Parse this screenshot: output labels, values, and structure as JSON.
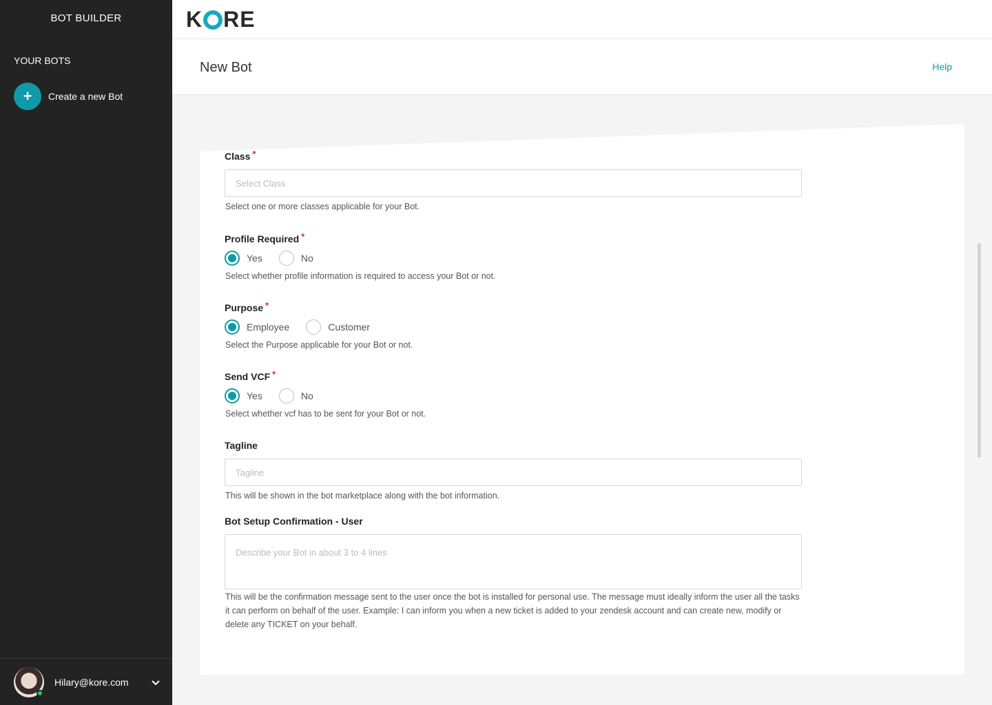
{
  "sidebar": {
    "title": "BOT BUILDER",
    "section_label": "YOUR BOTS",
    "create_label": "Create a new Bot",
    "create_icon": "+",
    "user_email": "Hilary@kore.com",
    "caret": "⌄"
  },
  "header": {
    "logo_k": "K",
    "logo_rest": "RE",
    "page_title": "New Bot",
    "help": "Help"
  },
  "form": {
    "class": {
      "label": "Class",
      "required": "*",
      "placeholder": "Select Class",
      "hint": "Select one or more classes applicable for your Bot."
    },
    "profile_required": {
      "label": "Profile Required",
      "required": "*",
      "options": [
        "Yes",
        "No"
      ],
      "selected": "Yes",
      "hint": "Select whether profile information is required to access your Bot or not."
    },
    "purpose": {
      "label": "Purpose",
      "required": "*",
      "options": [
        "Employee",
        "Customer"
      ],
      "selected": "Employee",
      "hint": "Select the Purpose applicable for your Bot or not."
    },
    "send_vcf": {
      "label": "Send VCF",
      "required": "*",
      "options": [
        "Yes",
        "No"
      ],
      "selected": "Yes",
      "hint": "Select whether vcf has to be sent for your Bot or not."
    },
    "tagline": {
      "label": "Tagline",
      "placeholder": "Tagline",
      "hint": "This will be shown in the bot marketplace along with the bot information."
    },
    "confirmation": {
      "label": "Bot Setup Confirmation - User",
      "placeholder": "Describe your Bot in about 3 to 4 lines",
      "hint": "This will be the confirmation message sent to the user once the bot is installed for personal use. The message must ideally inform the user all the tasks it can perform on behalf of the user. Example: I can inform you when a new ticket is added to your zendesk account and can create new, modify or delete any TICKET on your behalf."
    }
  },
  "colors": {
    "accent": "#0f9aa8",
    "sidebar_bg": "#232323",
    "required": "#e0262b"
  }
}
